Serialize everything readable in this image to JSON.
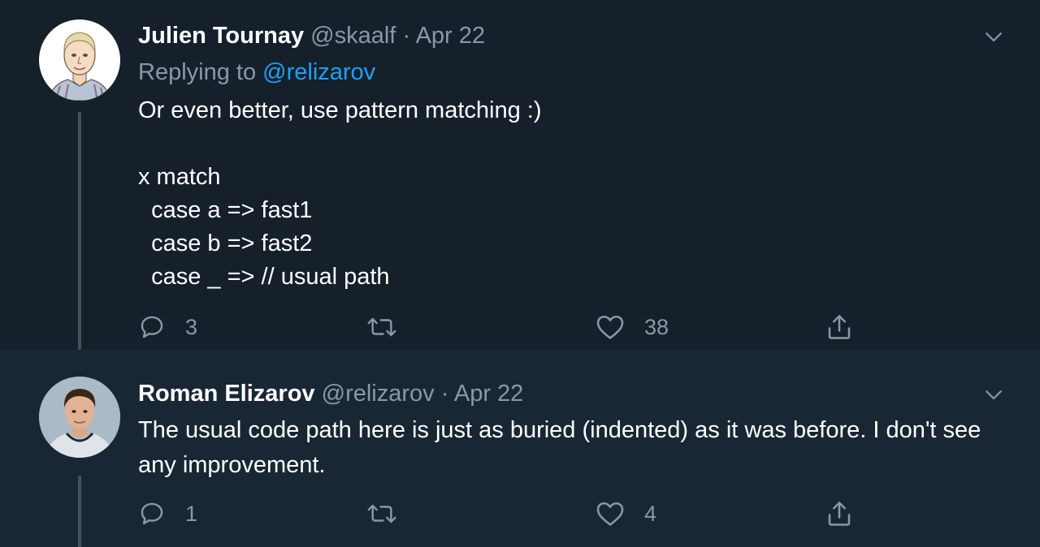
{
  "tweets": [
    {
      "display_name": "Julien Tournay",
      "handle": "@skaalf",
      "separator": "·",
      "date": "Apr 22",
      "replying_prefix": "Replying to",
      "replying_to": "@relizarov",
      "text": "Or even better, use pattern matching :)\n\nx match\n  case a => fast1\n  case b => fast2\n  case _ => // usual path",
      "actions": {
        "replies": "3",
        "retweets": "",
        "likes": "38"
      },
      "avatar_icon": "illustrated-portrait-avatar"
    },
    {
      "display_name": "Roman Elizarov",
      "handle": "@relizarov",
      "separator": "·",
      "date": "Apr 22",
      "text": "The usual code path here is just as buried (indented) as it was before. I don't see any improvement.",
      "actions": {
        "replies": "1",
        "retweets": "",
        "likes": "4"
      },
      "avatar_icon": "photo-portrait-avatar"
    }
  ],
  "colors": {
    "background": "#15202b",
    "background_alt": "#192734",
    "text": "#ffffff",
    "muted": "#8899a6",
    "link": "#1da1f2",
    "thread_line": "#3d5466"
  }
}
